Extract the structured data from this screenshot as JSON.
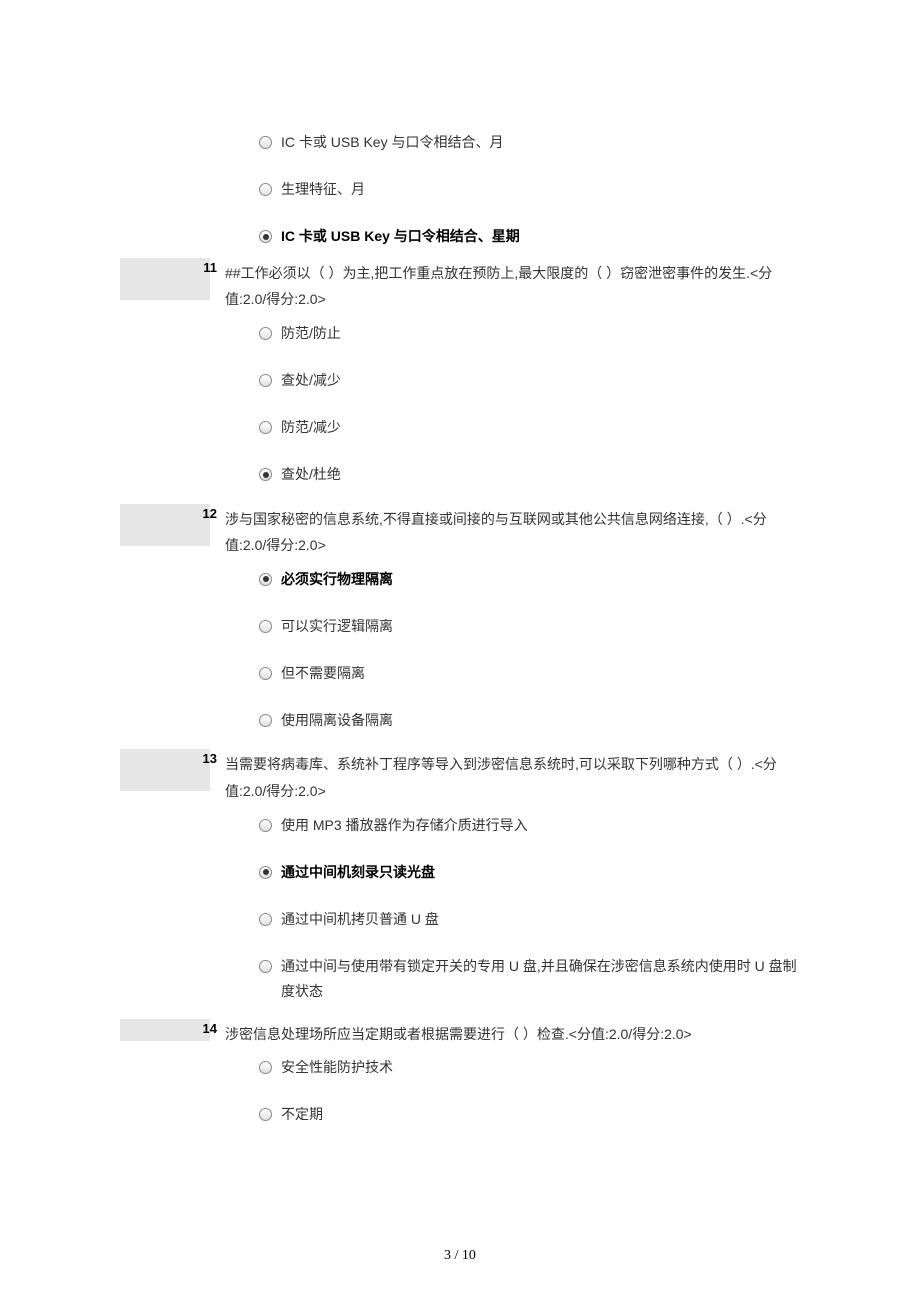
{
  "orphan_options": [
    {
      "text": "IC 卡或 USB Key 与口令相结合、月",
      "selected": false,
      "bold": false
    },
    {
      "text": "生理特征、月",
      "selected": false,
      "bold": false
    },
    {
      "text": "IC 卡或 USB Key 与口令相结合、星期",
      "selected": true,
      "bold": true
    }
  ],
  "questions": [
    {
      "number": "11",
      "text": "##工作必须以（ ）为主,把工作重点放在预防上,最大限度的（ ）窃密泄密事件的发生.<分值:2.0/得分:2.0>",
      "options": [
        {
          "text": "防范/防止",
          "selected": false,
          "bold": false
        },
        {
          "text": "查处/减少",
          "selected": false,
          "bold": false
        },
        {
          "text": "防范/减少",
          "selected": false,
          "bold": false
        },
        {
          "text": "查处/杜绝",
          "selected": true,
          "bold": false
        }
      ]
    },
    {
      "number": "12",
      "text": "涉与国家秘密的信息系统,不得直接或间接的与互联网或其他公共信息网络连接,（ ）.<分值:2.0/得分:2.0>",
      "options": [
        {
          "text": "必须实行物理隔离",
          "selected": true,
          "bold": true
        },
        {
          "text": "可以实行逻辑隔离",
          "selected": false,
          "bold": false
        },
        {
          "text": "但不需要隔离",
          "selected": false,
          "bold": false
        },
        {
          "text": "使用隔离设备隔离",
          "selected": false,
          "bold": false
        }
      ]
    },
    {
      "number": "13",
      "text": "当需要将病毒库、系统补丁程序等导入到涉密信息系统时,可以采取下列哪种方式（ ）.<分值:2.0/得分:2.0>",
      "options": [
        {
          "text": "使用 MP3 播放器作为存储介质进行导入",
          "selected": false,
          "bold": false
        },
        {
          "text": "通过中间机刻录只读光盘",
          "selected": true,
          "bold": true
        },
        {
          "text": "通过中间机拷贝普通 U 盘",
          "selected": false,
          "bold": false
        },
        {
          "text": "通过中间与使用带有锁定开关的专用 U 盘,并且确保在涉密信息系统内使用时 U 盘制度状态",
          "selected": false,
          "bold": false
        }
      ]
    },
    {
      "number": "14",
      "text": "涉密信息处理场所应当定期或者根据需要进行（ ）检查.<分值:2.0/得分:2.0>",
      "options_partial": [
        {
          "text": "安全性能防护技术",
          "selected": false,
          "bold": false
        },
        {
          "text": "不定期",
          "selected": false,
          "bold": false
        }
      ]
    }
  ],
  "footer": "3 / 10"
}
